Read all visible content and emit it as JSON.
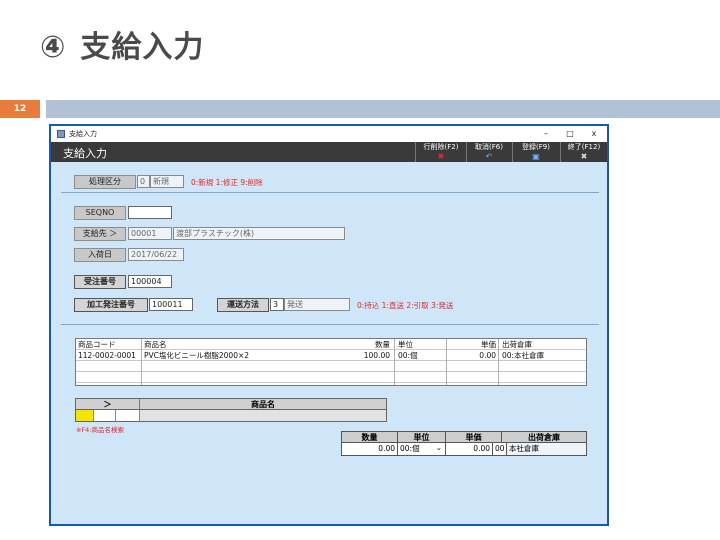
{
  "slide": {
    "number_symbol": "④",
    "title": "支給入力",
    "page_number": "12"
  },
  "window": {
    "titlebar_text": "支給入力",
    "min_glyph": "–",
    "max_glyph": "□",
    "close_glyph": "x",
    "header_title": "支給入力",
    "buttons": [
      {
        "label": "行削除(F2)",
        "icon": "✖"
      },
      {
        "label": "取消(F6)",
        "icon": "↶"
      },
      {
        "label": "登録(F9)",
        "icon": "▣"
      },
      {
        "label": "終了(F12)",
        "icon": "✖"
      }
    ]
  },
  "form": {
    "shori_label": "処理区分",
    "shori_code": "0",
    "shori_name": "新規",
    "shori_hint": "0:新規 1:修正 9:削除",
    "seqno_label": "SEQNO",
    "seqno_value": "",
    "shikyusaki_label": "支給先 ＞",
    "shikyusaki_code": "00001",
    "shikyusaki_name": "渡部プラスチック(株)",
    "nyukabi_label": "入荷日",
    "nyukabi_value": "2017/06/22",
    "juchu_label": "受注番号",
    "juchu_value": "100004",
    "kako_label": "加工発注番号",
    "kako_value": "100011",
    "unso_label": "運送方法",
    "unso_code": "3",
    "unso_name": "発送",
    "unso_hint": "0:持込 1:直送 2:引取 3:発送"
  },
  "grid": {
    "headers": [
      "商品コード",
      "商品名",
      "数量",
      "単位",
      "単価",
      "出荷倉庫"
    ],
    "rows": [
      [
        "112-0002-0001",
        "PVC塩化ビニール樹脂2000×2",
        "100.00",
        "00:個",
        "0.00",
        "00:本社倉庫"
      ]
    ]
  },
  "entry": {
    "arrow": "＞",
    "header": "商品名",
    "hint": "※F4:商品名検索"
  },
  "detail": {
    "headers": [
      "数量",
      "単位",
      "単価",
      "出荷倉庫"
    ],
    "qty": "0.00",
    "unit": "00:個",
    "dropdown_glyph": "⌄",
    "price": "0.00",
    "wh_code": "00",
    "wh_name": "本社倉庫"
  },
  "colors": {
    "accent": "#e77c3c",
    "window_bg": "#cfe6f8",
    "header_bg": "#3a3a3a",
    "hint": "#e0282a"
  }
}
